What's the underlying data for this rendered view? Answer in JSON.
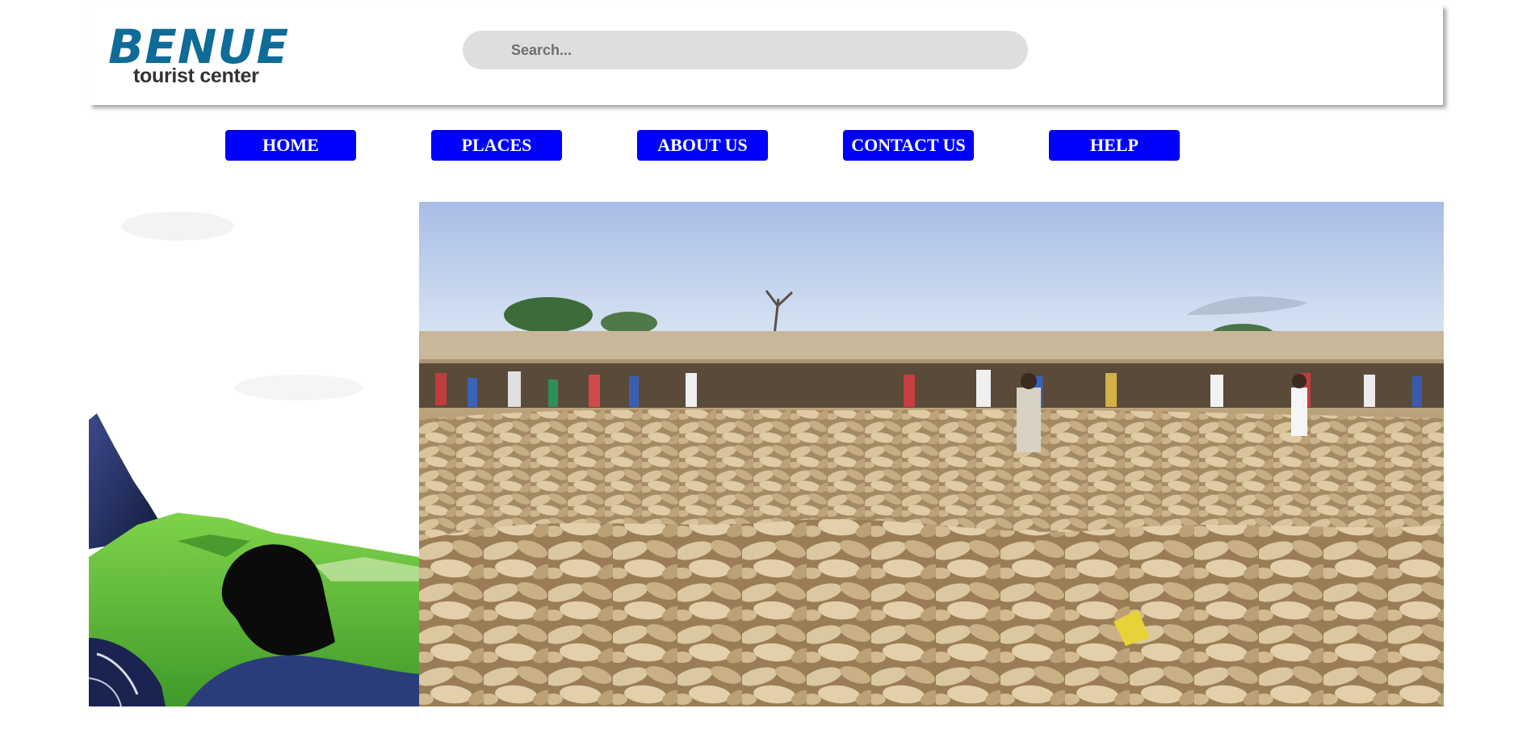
{
  "brand": {
    "logo_word": "BENUE",
    "logo_tagline": "tourist center",
    "logo_color": "#0f6c98"
  },
  "search": {
    "placeholder": "Search..."
  },
  "nav": {
    "items": [
      {
        "label": "HOME"
      },
      {
        "label": "PLACES"
      },
      {
        "label": "ABOUT US"
      },
      {
        "label": "CONTACT US"
      },
      {
        "label": "HELP"
      }
    ],
    "button_color": "#0000ff"
  },
  "hero": {
    "left_image": "hiker-on-green-hill",
    "right_image": "yam-market-crowd"
  }
}
